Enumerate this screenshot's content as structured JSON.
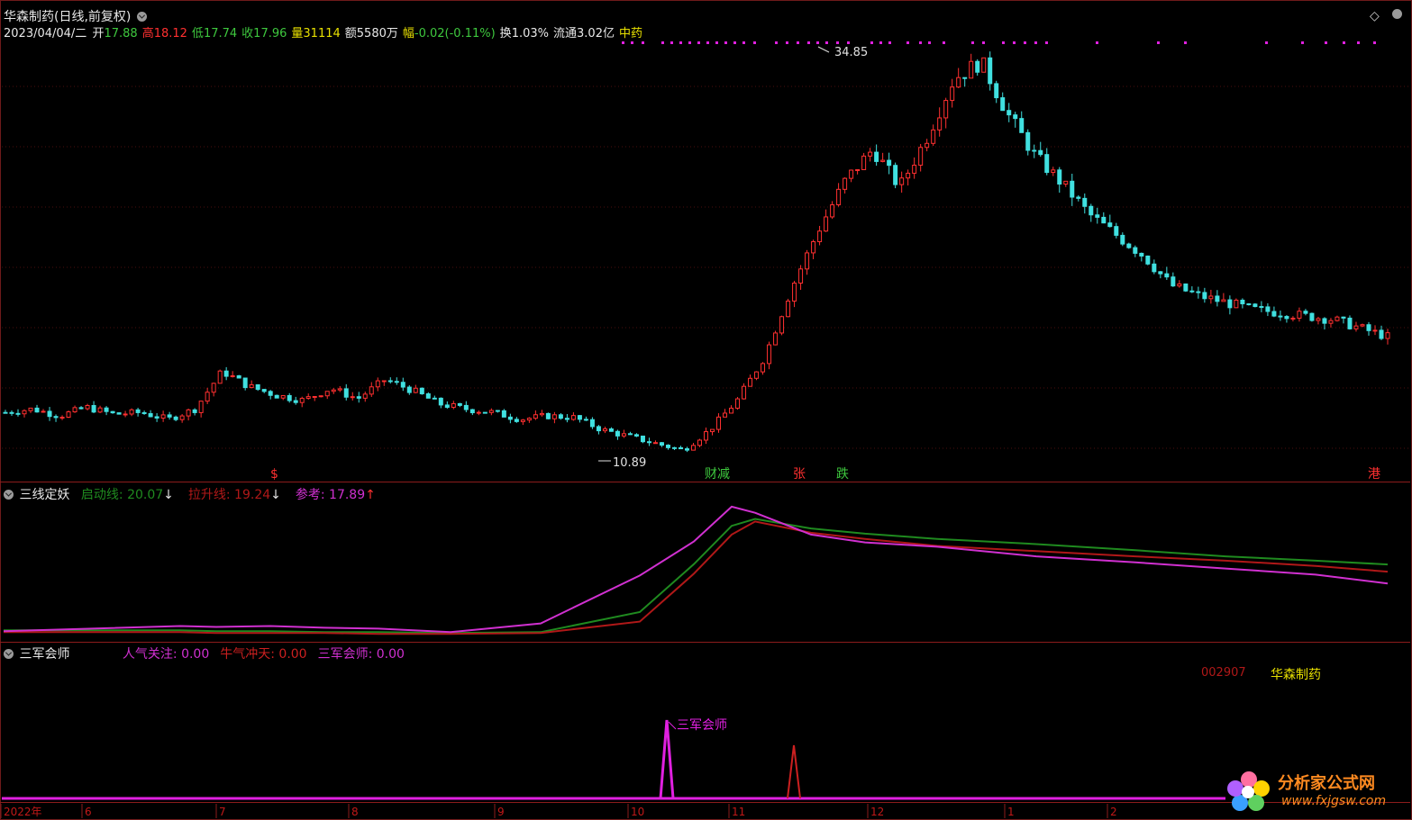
{
  "main": {
    "title": "华森制药(日线,前复权)",
    "date": "2023/04/04/二",
    "quote": [
      {
        "label": "开",
        "value": "17.88",
        "lc": "#e8e8e8",
        "vc": "#3ec83e"
      },
      {
        "label": "高",
        "value": "18.12",
        "lc": "#ff3030",
        "vc": "#ff3030"
      },
      {
        "label": "低",
        "value": "17.74",
        "lc": "#3ec83e",
        "vc": "#3ec83e"
      },
      {
        "label": "收",
        "value": "17.96",
        "lc": "#3ec83e",
        "vc": "#3ec83e"
      },
      {
        "label": "量",
        "value": "31114",
        "lc": "#e8e000",
        "vc": "#e8e000"
      },
      {
        "label": "额",
        "value": "5580万",
        "lc": "#e8e8e8",
        "vc": "#e8e8e8"
      },
      {
        "label": "幅",
        "value": "-0.02(-0.11%)",
        "lc": "#e8e000",
        "vc": "#3ec83e"
      },
      {
        "label": "换",
        "value": "1.03%",
        "lc": "#e8e8e8",
        "vc": "#e8e8e8"
      },
      {
        "label": "流通",
        "value": "3.02亿",
        "lc": "#e8e8e8",
        "vc": "#e8e8e8"
      },
      {
        "label": "",
        "value": "中药",
        "lc": "#e8e000",
        "vc": "#e8e000"
      }
    ],
    "high_marker": "34.85",
    "low_marker": "10.89",
    "signals": [
      {
        "text": "$",
        "color": "#ff3030"
      },
      {
        "text": "财减",
        "color": "#3ec83e"
      },
      {
        "text": "张",
        "color": "#ff3030"
      },
      {
        "text": "跌",
        "color": "#3ec83e"
      },
      {
        "text": "港",
        "color": "#ff3030"
      }
    ]
  },
  "ind1": {
    "name": "三线定妖",
    "items": [
      {
        "label": "启动线:",
        "value": "20.07",
        "arrow": "↓",
        "color": "#1f8a1f",
        "acolor": "#e0e0e0"
      },
      {
        "label": "拉升线:",
        "value": "19.24",
        "arrow": "↓",
        "color": "#b01818",
        "acolor": "#e0e0e0"
      },
      {
        "label": "参考:",
        "value": "17.89",
        "arrow": "↑",
        "color": "#d030d0",
        "acolor": "#ff3030"
      }
    ]
  },
  "ind2": {
    "name": "三军会师",
    "items": [
      {
        "label": "人气关注:",
        "value": "0.00",
        "color": "#d030d0"
      },
      {
        "label": "牛气冲天:",
        "value": "0.00",
        "color": "#cc2020"
      },
      {
        "label": "三军会师:",
        "value": "0.00",
        "color": "#d030d0"
      }
    ],
    "code": "002907",
    "stock_name": "华森制药",
    "spike_label": "三军会师"
  },
  "axis": {
    "labels": [
      "2022年",
      "6",
      "7",
      "8",
      "9",
      "10",
      "11",
      "12",
      "1",
      "2"
    ]
  },
  "watermark": {
    "title": "分析家公式网",
    "url": "www.fxjgsw.com"
  },
  "colors": {
    "up": "#ff3030",
    "down": "#40e0e0",
    "magenta": "#e020e0",
    "green": "#1f8a1f",
    "red": "#b01818",
    "grid": "#8b1c1c"
  },
  "chart_data": [
    {
      "type": "candlestick",
      "title": "华森制药(日线,前复权)",
      "x_start": "2022年",
      "x_end": "2023/04/04",
      "ylim": [
        10.89,
        34.85
      ],
      "points_close": [
        13.6,
        13.8,
        13.4,
        13.9,
        13.5,
        13.6,
        13.2,
        13.8,
        16.0,
        15.1,
        14.6,
        14.3,
        15.0,
        14.4,
        15.5,
        14.9,
        14.1,
        13.8,
        13.6,
        13.2,
        13.4,
        13.3,
        12.6,
        12.2,
        11.8,
        11.4,
        12.6,
        14.3,
        16.8,
        20.8,
        24.2,
        27.1,
        28.9,
        26.7,
        29.6,
        33.0,
        34.0,
        30.9,
        28.5,
        26.9,
        25.1,
        23.9,
        22.7,
        21.0,
        20.4,
        20.0,
        19.6,
        19.4,
        19.2,
        19.0,
        18.5,
        18.0
      ],
      "high": 34.85,
      "low": 10.89
    },
    {
      "type": "line",
      "title": "三线定妖",
      "series": [
        {
          "name": "启动线",
          "values": [
            12.5,
            12.5,
            12.4,
            12.4,
            12.3,
            12.3,
            12.2,
            12.3,
            14.6,
            20.1,
            24.5,
            25.3,
            24.2,
            23.6,
            23.0,
            22.4,
            21.7,
            21.0,
            20.5,
            20.07
          ],
          "color": "#1f8a1f"
        },
        {
          "name": "拉升线",
          "values": [
            12.3,
            12.3,
            12.2,
            12.2,
            12.2,
            12.1,
            12.1,
            12.2,
            13.5,
            19.0,
            23.5,
            25.0,
            23.7,
            23.0,
            22.2,
            21.6,
            21.0,
            20.5,
            19.9,
            19.24
          ],
          "color": "#b01818"
        },
        {
          "name": "参考",
          "values": [
            12.4,
            13.0,
            12.9,
            13.0,
            12.8,
            12.7,
            12.3,
            13.3,
            18.8,
            22.7,
            26.7,
            26.0,
            23.5,
            22.6,
            22.1,
            21.0,
            20.3,
            19.6,
            18.9,
            17.89
          ],
          "color": "#d030d0"
        }
      ]
    },
    {
      "type": "line",
      "title": "三军会师",
      "series": [
        {
          "name": "人气关注",
          "values": [
            0,
            0,
            0,
            0,
            0,
            0,
            0,
            0,
            0,
            0
          ],
          "color": "#d030d0"
        },
        {
          "name": "牛气冲天",
          "values": [
            0,
            0,
            0,
            0,
            0,
            0,
            0,
            0,
            0,
            0
          ],
          "color": "#cc2020"
        },
        {
          "name": "三军会师",
          "values": [
            0,
            0,
            0,
            0,
            0,
            0,
            0,
            0,
            0,
            0
          ],
          "color": "#d030d0"
        }
      ]
    }
  ]
}
